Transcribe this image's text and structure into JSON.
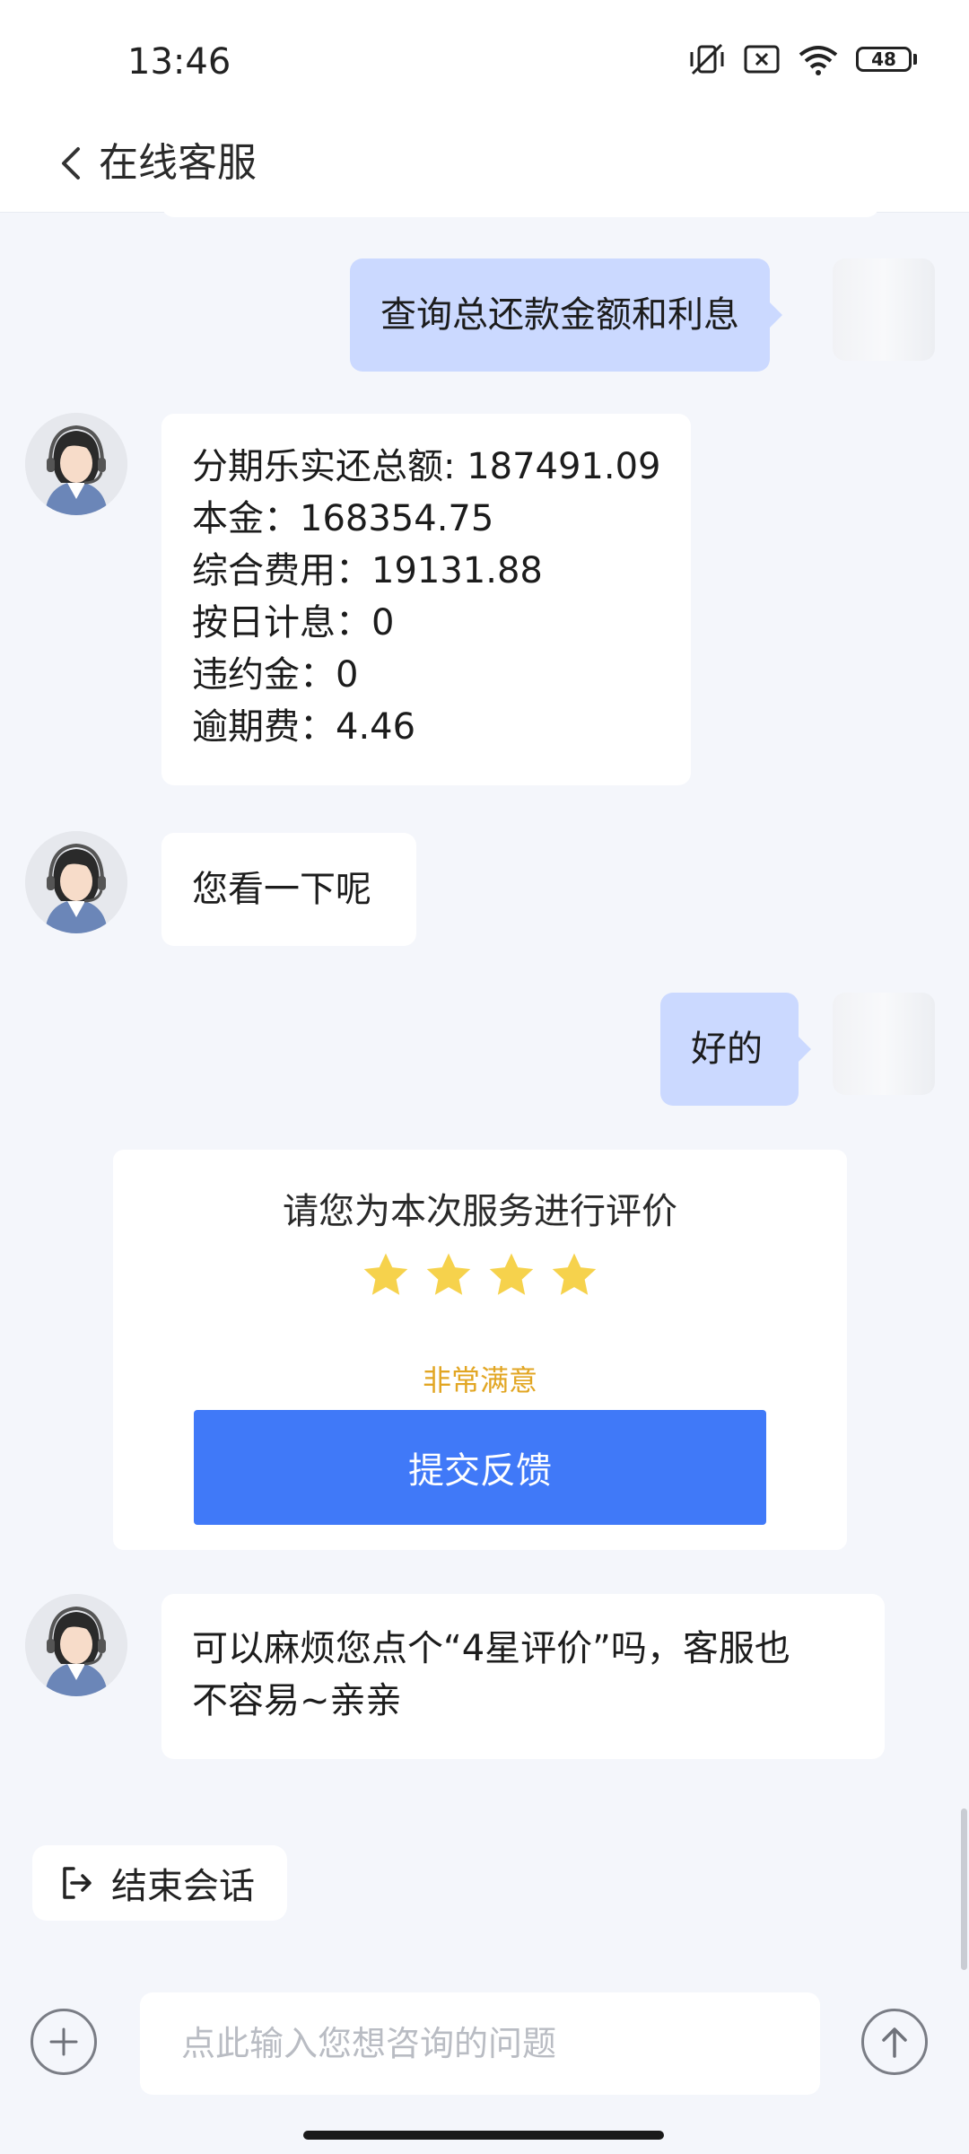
{
  "status_bar": {
    "time": "13:46",
    "battery": "48"
  },
  "header": {
    "title": "在线客服"
  },
  "messages": {
    "query": "查询总还款金额和利息",
    "details": [
      "分期乐实还总额: 187491.09",
      "本金：168354.75",
      "综合费用：19131.88",
      "按日计息：0",
      "违约金：0",
      "逾期费：4.46"
    ],
    "agent_prompt": "您看一下呢",
    "user_reply": "好的",
    "agent_request_line1": "可以麻烦您点个“4星评价”吗，客服也",
    "agent_request_line2": "不容易~亲亲"
  },
  "rating": {
    "prompt": "请您为本次服务进行评价",
    "stars": 4,
    "level": "非常满意",
    "submit_label": "提交反馈"
  },
  "end_session": {
    "label": "结束会话"
  },
  "input": {
    "placeholder": "点此输入您想咨询的问题"
  },
  "colors": {
    "accent": "#4079f8",
    "outgoing_bubble": "#cbd9ff",
    "star": "#f6d24c",
    "rating_text": "#e2a623"
  }
}
